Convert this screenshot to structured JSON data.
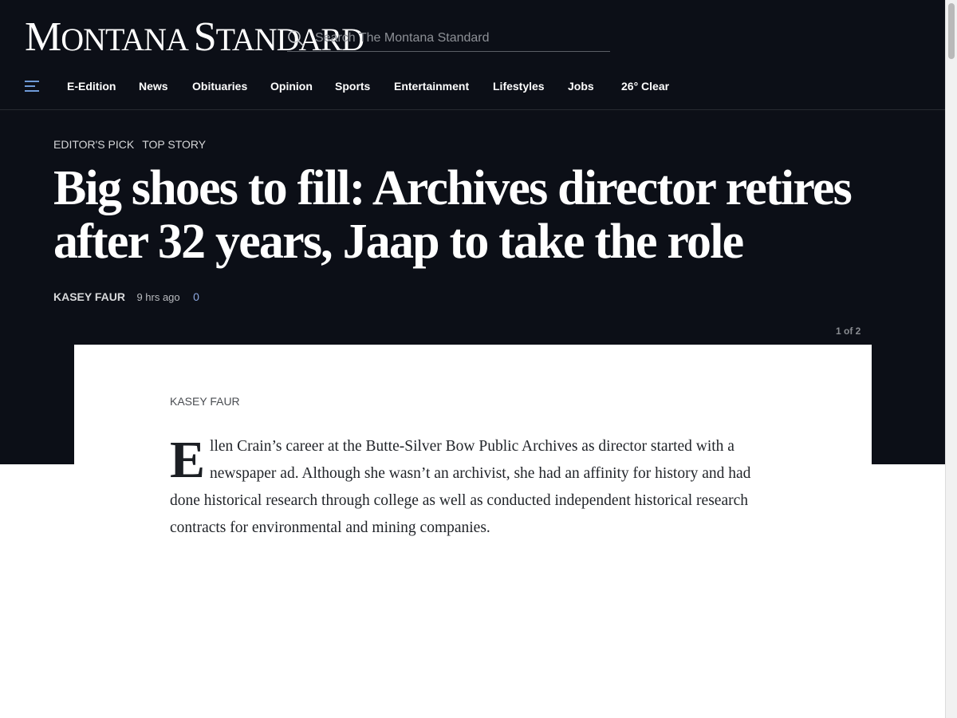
{
  "header": {
    "logo_text_1": "M",
    "logo_text_2": "ONTANA ",
    "logo_text_3": "S",
    "logo_text_4": "TANDARD",
    "search_placeholder": "Search The Montana Standard"
  },
  "nav": {
    "items": [
      "E-Edition",
      "News",
      "Obituaries",
      "Opinion",
      "Sports",
      "Entertainment",
      "Lifestyles",
      "Jobs"
    ],
    "weather": "26° Clear"
  },
  "article": {
    "flags": [
      "EDITOR'S PICK",
      "TOP STORY"
    ],
    "headline": "Big shoes to fill: Archives director retires after 32 years, Jaap to take the role",
    "author": "KASEY FAUR",
    "time": "9 hrs ago",
    "comments": "0",
    "counter": "1 of 2",
    "card_author": "KASEY FAUR",
    "dropcap": "E",
    "body_text": "llen Crain’s career at the Butte-Silver Bow Public Archives as director started with a newspaper ad. Although she wasn’t an archivist, she had an affinity for history and had done historical research through college as well as conducted independent historical research contracts for environmental and mining companies."
  },
  "colors": {
    "header_bg": "#0c0f17",
    "comment_link": "#8ea8e0"
  }
}
